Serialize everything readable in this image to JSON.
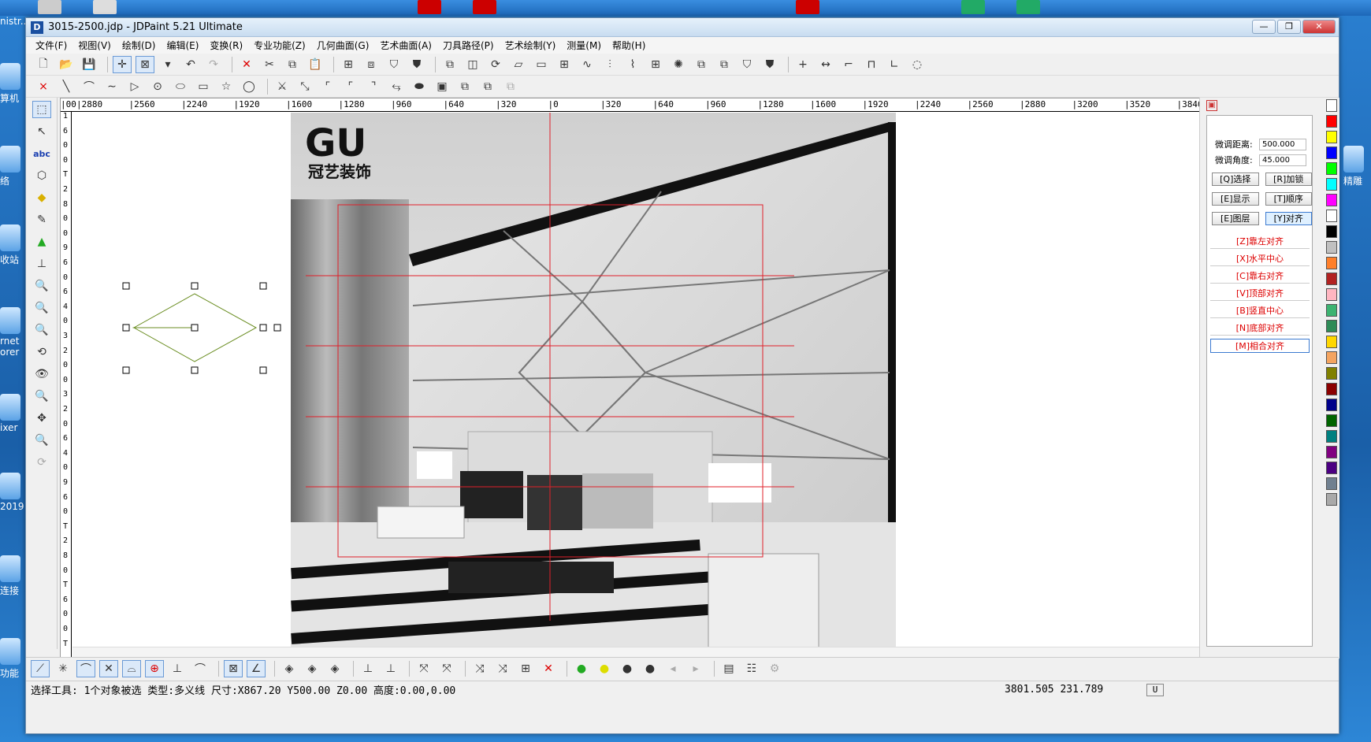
{
  "window": {
    "title": "3015-2500.jdp - JDPaint 5.21 Ultimate",
    "app_icon": "D",
    "buttons": [
      "—",
      "❐",
      "✕"
    ]
  },
  "desktop_icons": [
    {
      "label": "nistr.."
    },
    {
      "label": "算机"
    },
    {
      "label": "络"
    },
    {
      "label": "收站"
    },
    {
      "label": "rnet\norer"
    },
    {
      "label": "ixer"
    },
    {
      "label": "2019"
    },
    {
      "label": "连接"
    },
    {
      "label": "功能"
    },
    {
      "label": "精雕"
    }
  ],
  "menu": [
    "文件(F)",
    "视图(V)",
    "绘制(D)",
    "编辑(E)",
    "变换(R)",
    "专业功能(Z)",
    "几何曲面(G)",
    "艺术曲面(A)",
    "刀具路径(P)",
    "艺术绘制(Y)",
    "测量(M)",
    "帮助(H)"
  ],
  "ruler": {
    "unit": "mm",
    "h_labels": [
      "00",
      "2880",
      "2560",
      "2240",
      "1920",
      "1600",
      "1280",
      "960",
      "640",
      "320",
      "0",
      "320",
      "640",
      "960",
      "1280",
      "1600",
      "1920",
      "2240",
      "2560",
      "2880",
      "3200",
      "3520",
      "3840"
    ],
    "v_labels": [
      "1",
      "6",
      "0",
      "0",
      "T",
      "2",
      "8",
      "0",
      "0",
      "9",
      "6",
      "0",
      "6",
      "4",
      "0",
      "3",
      "2",
      "0",
      "0",
      "3",
      "2",
      "0",
      "6",
      "4",
      "0",
      "9",
      "6",
      "0",
      "T",
      "2",
      "8",
      "0",
      "T",
      "6",
      "0",
      "0",
      "T"
    ]
  },
  "logo": {
    "text": "冠艺装饰"
  },
  "props": {
    "fine_dist_label": "微调距离:",
    "fine_dist_value": "500.000",
    "fine_angle_label": "微调角度:",
    "fine_angle_value": "45.000",
    "btn_select": "[Q]选择",
    "btn_lock": "[R]加锁",
    "btn_show": "[E]显示",
    "btn_order": "[T]顺序",
    "btn_layer": "[E]图层",
    "btn_align": "[Y]对齐",
    "align_items": [
      "[Z]靠左对齐",
      "[X]水平中心",
      "[C]靠右对齐",
      "[V]顶部对齐",
      "[B]竖直中心",
      "[N]底部对齐",
      "[M]相合对齐"
    ]
  },
  "palette": [
    "#ff0000",
    "#ffff00",
    "#0000ff",
    "#00ff00",
    "#00ffff",
    "#ff00ff",
    "#ffffff",
    "#000000",
    "#c0c0c0",
    "#ff7f2a",
    "#b22222",
    "#ffb6c1",
    "#3cb371",
    "#2e8b57",
    "#ffd700",
    "#f4a460",
    "#808000",
    "#8b0000",
    "#00008b",
    "#006400",
    "#008080",
    "#800080",
    "#4b0082",
    "#708090",
    "#a9a9a9"
  ],
  "status": {
    "text": "选择工具: 1个对象被选 类型:多义线 尺寸:X867.20 Y500.00 Z0.00 高度:0.00,0.00",
    "coords": "3801.505 231.789",
    "mode": "U"
  },
  "colors": {
    "guide_red": "#e0202a",
    "diamond_green": "#6b8e23"
  }
}
